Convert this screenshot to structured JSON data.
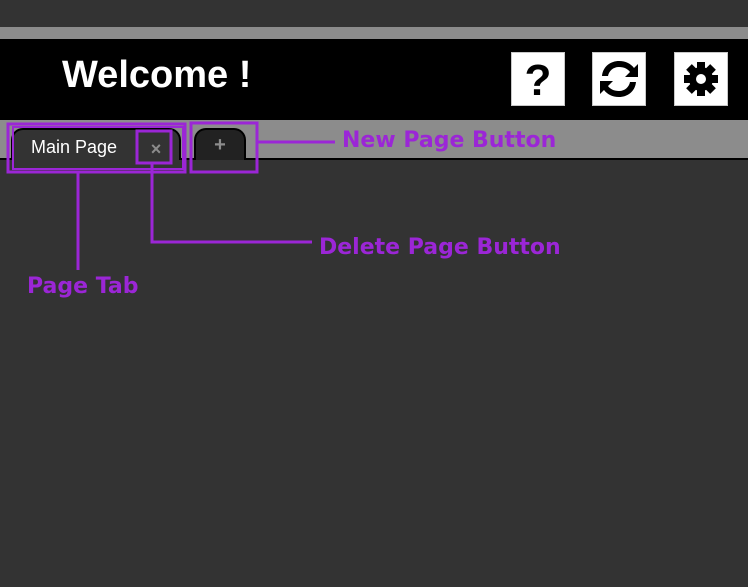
{
  "header": {
    "title": "Welcome !",
    "buttons": [
      {
        "name": "help",
        "icon": "question-icon"
      },
      {
        "name": "refresh",
        "icon": "refresh-icon"
      },
      {
        "name": "settings",
        "icon": "gear-icon"
      }
    ]
  },
  "tabs": {
    "items": [
      {
        "label": "Main Page",
        "close_label": "×"
      }
    ],
    "new_tab_label": "+"
  },
  "annotations": {
    "new_page_button": "New Page Button",
    "delete_page_button": "Delete Page Button",
    "page_tab": "Page Tab",
    "color": "#9b26d6"
  },
  "colors": {
    "background": "#333333",
    "header": "#000000",
    "tabbar": "#8c8c8c",
    "annotation": "#9b26d6"
  }
}
